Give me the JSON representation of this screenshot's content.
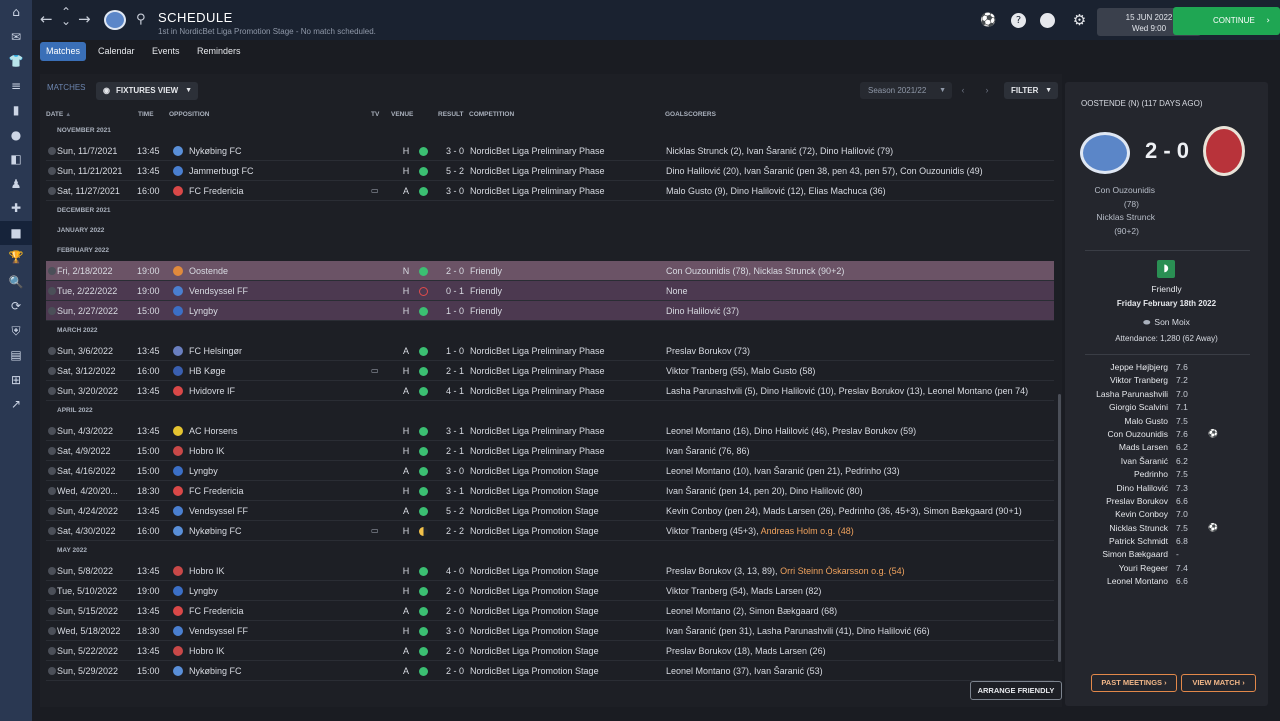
{
  "rail": [
    "⌂",
    "✉",
    "👕",
    "≡",
    "▮",
    "●",
    "◧",
    "♟",
    "✚",
    "■",
    "🏆",
    "🔍",
    "⟳",
    "⛨",
    "▤",
    "⊞",
    "↗"
  ],
  "header": {
    "title": "SCHEDULE",
    "subtitle": "1st in NordicBet Liga Promotion Stage - No match scheduled.",
    "date": "15 JUN 2022",
    "time": "Wed 9:00",
    "continue_label": "CONTINUE"
  },
  "tabs": [
    "Matches",
    "Calendar",
    "Events",
    "Reminders"
  ],
  "toolbar": {
    "matches_label": "MATCHES",
    "view_label": "FIXTURES VIEW",
    "season": "Season 2021/22",
    "filter_label": "FILTER"
  },
  "columns": {
    "date": "DATE",
    "time": "TIME",
    "opposition": "OPPOSITION",
    "tv": "TV",
    "venue": "VENUE",
    "result": "RESULT",
    "competition": "COMPETITION",
    "goalscorers": "GOALSCORERS"
  },
  "rows": [
    {
      "type": "month",
      "label": "NOVEMBER 2021"
    },
    {
      "type": "match",
      "date": "Sun, 11/7/2021",
      "time": "13:45",
      "opp": "Nykøbing FC",
      "crest": "#5a8fd8",
      "tv": "",
      "venue": "H",
      "outcome": "W",
      "result": "3 - 0",
      "comp": "NordicBet Liga Preliminary Phase",
      "goals": "Nicklas Strunck (2), Ivan Šaranić (72), Dino Halilović (79)",
      "og": ""
    },
    {
      "type": "match",
      "date": "Sun, 11/21/2021",
      "time": "13:45",
      "opp": "Jammerbugt FC",
      "crest": "#4a7fd0",
      "tv": "",
      "venue": "H",
      "outcome": "W",
      "result": "5 - 2",
      "comp": "NordicBet Liga Preliminary Phase",
      "goals": "Dino Halilović (20), Ivan Šaranić (pen 38, pen 43, pen 57), Con Ouzounidis (49)",
      "og": ""
    },
    {
      "type": "match",
      "date": "Sat, 11/27/2021",
      "time": "16:00",
      "opp": "FC Fredericia",
      "crest": "#d94848",
      "tv": "▭",
      "venue": "A",
      "outcome": "W",
      "result": "3 - 0",
      "comp": "NordicBet Liga Preliminary Phase",
      "goals": "Malo Gusto (9), Dino Halilović (12), Elias Machuca (36)",
      "og": ""
    },
    {
      "type": "month",
      "label": "DECEMBER 2021"
    },
    {
      "type": "month",
      "label": "JANUARY 2022"
    },
    {
      "type": "month",
      "label": "FEBRUARY 2022"
    },
    {
      "type": "match",
      "hl": "hl1",
      "date": "Fri, 2/18/2022",
      "time": "19:00",
      "opp": "Oostende",
      "crest": "#e08a3c",
      "tv": "",
      "venue": "N",
      "outcome": "W",
      "result": "2 - 0",
      "comp": "Friendly",
      "goals": "Con Ouzounidis (78), Nicklas Strunck (90+2)",
      "og": ""
    },
    {
      "type": "match",
      "hl": "hl2",
      "date": "Tue, 2/22/2022",
      "time": "19:00",
      "opp": "Vendsyssel FF",
      "crest": "#4a7fd0",
      "tv": "",
      "venue": "H",
      "outcome": "L",
      "result": "0 - 1",
      "comp": "Friendly",
      "goals": "None",
      "og": ""
    },
    {
      "type": "match",
      "hl": "hl2",
      "date": "Sun, 2/27/2022",
      "time": "15:00",
      "opp": "Lyngby",
      "crest": "#3b6fc6",
      "tv": "",
      "venue": "H",
      "outcome": "W",
      "result": "1 - 0",
      "comp": "Friendly",
      "goals": "Dino Halilović (37)",
      "og": ""
    },
    {
      "type": "month",
      "label": "MARCH 2022"
    },
    {
      "type": "match",
      "date": "Sun, 3/6/2022",
      "time": "13:45",
      "opp": "FC Helsingør",
      "crest": "#6a7fc0",
      "tv": "",
      "venue": "A",
      "outcome": "W",
      "result": "1 - 0",
      "comp": "NordicBet Liga Preliminary Phase",
      "goals": "Preslav Borukov (73)",
      "og": ""
    },
    {
      "type": "match",
      "date": "Sat, 3/12/2022",
      "time": "16:00",
      "opp": "HB Køge",
      "crest": "#3a5fb0",
      "tv": "▭",
      "venue": "H",
      "outcome": "W",
      "result": "2 - 1",
      "comp": "NordicBet Liga Preliminary Phase",
      "goals": "Viktor Tranberg (55), Malo Gusto (58)",
      "og": ""
    },
    {
      "type": "match",
      "date": "Sun, 3/20/2022",
      "time": "13:45",
      "opp": "Hvidovre IF",
      "crest": "#d94848",
      "tv": "",
      "venue": "A",
      "outcome": "W",
      "result": "4 - 1",
      "comp": "NordicBet Liga Preliminary Phase",
      "goals": "Lasha Parunashvili (5), Dino Halilović (10), Preslav Borukov (13), Leonel Montano (pen 74)",
      "og": ""
    },
    {
      "type": "month",
      "label": "APRIL 2022"
    },
    {
      "type": "match",
      "date": "Sun, 4/3/2022",
      "time": "13:45",
      "opp": "AC Horsens",
      "crest": "#e5c330",
      "tv": "",
      "venue": "H",
      "outcome": "W",
      "result": "3 - 1",
      "comp": "NordicBet Liga Preliminary Phase",
      "goals": "Leonel Montano (16), Dino Halilović (46), Preslav Borukov (59)",
      "og": ""
    },
    {
      "type": "match",
      "date": "Sat, 4/9/2022",
      "time": "15:00",
      "opp": "Hobro IK",
      "crest": "#c84848",
      "tv": "",
      "venue": "H",
      "outcome": "W",
      "result": "2 - 1",
      "comp": "NordicBet Liga Preliminary Phase",
      "goals": "Ivan Šaranić (76, 86)",
      "og": ""
    },
    {
      "type": "match",
      "date": "Sat, 4/16/2022",
      "time": "15:00",
      "opp": "Lyngby",
      "crest": "#3b6fc6",
      "tv": "",
      "venue": "A",
      "outcome": "W",
      "result": "3 - 0",
      "comp": "NordicBet Liga Promotion Stage",
      "goals": "Leonel Montano (10), Ivan Šaranić (pen 21), Pedrinho (33)",
      "og": ""
    },
    {
      "type": "match",
      "date": "Wed, 4/20/20...",
      "time": "18:30",
      "opp": "FC Fredericia",
      "crest": "#d94848",
      "tv": "",
      "venue": "H",
      "outcome": "W",
      "result": "3 - 1",
      "comp": "NordicBet Liga Promotion Stage",
      "goals": "Ivan Šaranić (pen 14, pen 20), Dino Halilović (80)",
      "og": ""
    },
    {
      "type": "match",
      "date": "Sun, 4/24/2022",
      "time": "13:45",
      "opp": "Vendsyssel FF",
      "crest": "#4a7fd0",
      "tv": "",
      "venue": "A",
      "outcome": "W",
      "result": "5 - 2",
      "comp": "NordicBet Liga Promotion Stage",
      "goals": "Kevin Conboy (pen 24), Mads Larsen (26), Pedrinho (36, 45+3), Simon Bækgaard (90+1)",
      "og": ""
    },
    {
      "type": "match",
      "date": "Sat, 4/30/2022",
      "time": "16:00",
      "opp": "Nykøbing FC",
      "crest": "#5a8fd8",
      "tv": "▭",
      "venue": "H",
      "outcome": "D",
      "result": "2 - 2",
      "comp": "NordicBet Liga Promotion Stage",
      "goals": "Viktor Tranberg (45+3),",
      "og": "Andreas Holm o.g. (48)"
    },
    {
      "type": "month",
      "label": "MAY 2022"
    },
    {
      "type": "match",
      "date": "Sun, 5/8/2022",
      "time": "13:45",
      "opp": "Hobro IK",
      "crest": "#c84848",
      "tv": "",
      "venue": "H",
      "outcome": "W",
      "result": "4 - 0",
      "comp": "NordicBet Liga Promotion Stage",
      "goals": "Preslav Borukov (3, 13, 89),",
      "og": "Orri Steinn Óskarsson o.g. (54)"
    },
    {
      "type": "match",
      "date": "Tue, 5/10/2022",
      "time": "19:00",
      "opp": "Lyngby",
      "crest": "#3b6fc6",
      "tv": "",
      "venue": "H",
      "outcome": "W",
      "result": "2 - 0",
      "comp": "NordicBet Liga Promotion Stage",
      "goals": "Viktor Tranberg (54), Mads Larsen (82)",
      "og": ""
    },
    {
      "type": "match",
      "date": "Sun, 5/15/2022",
      "time": "13:45",
      "opp": "FC Fredericia",
      "crest": "#d94848",
      "tv": "",
      "venue": "A",
      "outcome": "W",
      "result": "2 - 0",
      "comp": "NordicBet Liga Promotion Stage",
      "goals": "Leonel Montano (2), Simon Bækgaard (68)",
      "og": ""
    },
    {
      "type": "match",
      "date": "Wed, 5/18/2022",
      "time": "18:30",
      "opp": "Vendsyssel FF",
      "crest": "#4a7fd0",
      "tv": "",
      "venue": "H",
      "outcome": "W",
      "result": "3 - 0",
      "comp": "NordicBet Liga Promotion Stage",
      "goals": "Ivan Šaranić (pen 31), Lasha Parunashvili (41), Dino Halilović (66)",
      "og": ""
    },
    {
      "type": "match",
      "date": "Sun, 5/22/2022",
      "time": "13:45",
      "opp": "Hobro IK",
      "crest": "#c84848",
      "tv": "",
      "venue": "A",
      "outcome": "W",
      "result": "2 - 0",
      "comp": "NordicBet Liga Promotion Stage",
      "goals": "Preslav Borukov (18), Mads Larsen (26)",
      "og": ""
    },
    {
      "type": "match",
      "date": "Sun, 5/29/2022",
      "time": "15:00",
      "opp": "Nykøbing FC",
      "crest": "#5a8fd8",
      "tv": "",
      "venue": "A",
      "outcome": "W",
      "result": "2 - 0",
      "comp": "NordicBet Liga Promotion Stage",
      "goals": "Leonel Montano (37), Ivan Šaranić (53)",
      "og": ""
    }
  ],
  "arrange_label": "ARRANGE FRIENDLY",
  "side": {
    "title": "OOSTENDE (N) (117 DAYS AGO)",
    "score": "2 - 0",
    "scorer_lines": [
      "Con Ouzounidis",
      "(78)",
      "Nicklas Strunck",
      "(90+2)"
    ],
    "competition": "Friendly",
    "match_date": "Friday February 18th 2022",
    "stadium": "Son Moix",
    "attendance": "Attendance: 1,280 (62 Away)",
    "players": [
      {
        "name": "Jeppe Højbjerg",
        "rating": "7.6",
        "mark": ""
      },
      {
        "name": "Viktor Tranberg",
        "rating": "7.2",
        "mark": ""
      },
      {
        "name": "Lasha Parunashvili",
        "rating": "7.0",
        "mark": ""
      },
      {
        "name": "Giorgio Scalvini",
        "rating": "7.1",
        "mark": ""
      },
      {
        "name": "Malo Gusto",
        "rating": "7.5",
        "mark": ""
      },
      {
        "name": "Con Ouzounidis",
        "rating": "7.6",
        "mark": "⚽"
      },
      {
        "name": "Mads Larsen",
        "rating": "6.2",
        "mark": ""
      },
      {
        "name": "Ivan Šaranić",
        "rating": "6.2",
        "mark": ""
      },
      {
        "name": "Pedrinho",
        "rating": "7.5",
        "mark": ""
      },
      {
        "name": "Dino Halilović",
        "rating": "7.3",
        "mark": ""
      },
      {
        "name": "Preslav Borukov",
        "rating": "6.6",
        "mark": ""
      },
      {
        "name": "Kevin Conboy",
        "rating": "7.0",
        "mark": ""
      },
      {
        "name": "Nicklas Strunck",
        "rating": "7.5",
        "mark": "⚽"
      },
      {
        "name": "Patrick Schmidt",
        "rating": "6.8",
        "mark": ""
      },
      {
        "name": "Simon Bækgaard",
        "rating": "-",
        "mark": ""
      },
      {
        "name": "Youri Regeer",
        "rating": "7.4",
        "mark": ""
      },
      {
        "name": "Leonel Montano",
        "rating": "6.6",
        "mark": ""
      }
    ],
    "past_meetings_label": "PAST MEETINGS",
    "view_match_label": "VIEW MATCH"
  },
  "colors": {
    "accent": "#3a6fb7",
    "continue": "#1fa653",
    "win": "#3bbf72",
    "loss": "#e04b4b",
    "draw": "#f2c14a",
    "highlight": "#6b5366",
    "highlight_alt": "#4c3950",
    "og_text": "#f0a35e"
  }
}
